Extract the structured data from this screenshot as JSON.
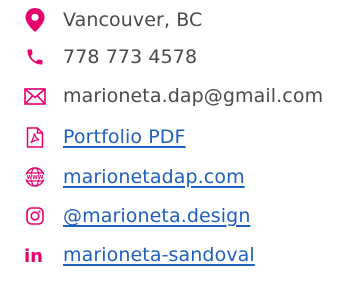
{
  "accent_color": "#e6006e",
  "link_color": "#1f5fbf",
  "text_color": "#4a4a4a",
  "contacts": [
    {
      "icon": "location-pin-icon",
      "text": "Vancouver, BC",
      "is_link": false
    },
    {
      "icon": "phone-icon",
      "text": "778 773 4578",
      "is_link": false
    },
    {
      "icon": "email-icon",
      "text": "marioneta.dap@gmail.com",
      "is_link": false
    },
    {
      "icon": "pdf-file-icon",
      "text": "Portfolio PDF",
      "is_link": true
    },
    {
      "icon": "globe-www-icon",
      "text": "marionetadap.com",
      "is_link": true
    },
    {
      "icon": "instagram-icon",
      "text": "@marioneta.design",
      "is_link": true
    },
    {
      "icon": "linkedin-icon",
      "text": "marioneta-sandoval",
      "is_link": true
    }
  ]
}
